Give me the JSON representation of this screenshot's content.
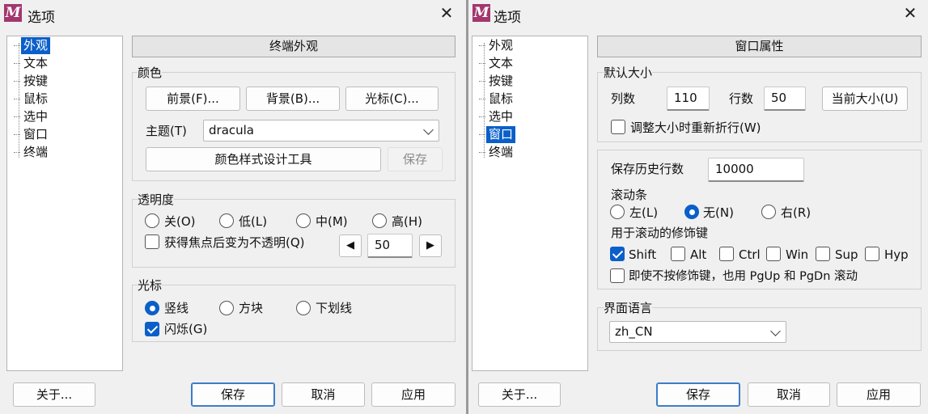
{
  "left": {
    "window_title": "选项",
    "tree": [
      "外观",
      "文本",
      "按键",
      "鼠标",
      "选中",
      "窗口",
      "终端"
    ],
    "selected_tree_index": 0,
    "panel_title": "终端外观",
    "color_group": {
      "label": "颜色",
      "fg_button": "前景(F)...",
      "bg_button": "背景(B)...",
      "cursor_button": "光标(C)...",
      "theme_label": "主题(T)",
      "theme_value": "dracula",
      "designer_button": "颜色样式设计工具",
      "save_button": "保存"
    },
    "transparency_group": {
      "label": "透明度",
      "options": [
        "关(O)",
        "低(L)",
        "中(M)",
        "高(H)"
      ],
      "selected": null,
      "opaque_on_focus_label": "获得焦点后变为不透明(Q)",
      "opaque_on_focus_checked": false,
      "value": "50"
    },
    "cursor_group": {
      "label": "光标",
      "options": [
        "竖线",
        "方块",
        "下划线"
      ],
      "selected": 0,
      "blink_label": "闪烁(G)",
      "blink_checked": true
    },
    "footer": {
      "about": "关于...",
      "save": "保存",
      "cancel": "取消",
      "apply": "应用"
    }
  },
  "right": {
    "window_title": "选项",
    "tree": [
      "外观",
      "文本",
      "按键",
      "鼠标",
      "选中",
      "窗口",
      "终端"
    ],
    "selected_tree_index": 5,
    "panel_title": "窗口属性",
    "size_group": {
      "label": "默认大小",
      "cols_label": "列数",
      "cols_value": "110",
      "rows_label": "行数",
      "rows_value": "50",
      "current_size_button": "当前大小(U)",
      "rewrap_label": "调整大小时重新折行(W)",
      "rewrap_checked": false
    },
    "scroll_group": {
      "history_label": "保存历史行数",
      "history_value": "10000",
      "scrollbar_label": "滚动条",
      "scrollbar_options": [
        "左(L)",
        "无(N)",
        "右(R)"
      ],
      "scrollbar_selected": 1,
      "modifier_label": "用于滚动的修饰键",
      "modifiers": [
        {
          "label": "Shift",
          "checked": true
        },
        {
          "label": "Alt",
          "checked": false
        },
        {
          "label": "Ctrl",
          "checked": false
        },
        {
          "label": "Win",
          "checked": false
        },
        {
          "label": "Sup",
          "checked": false
        },
        {
          "label": "Hyp",
          "checked": false
        }
      ],
      "pgup_label": "即使不按修饰键，也用 PgUp 和 PgDn 滚动",
      "pgup_checked": false
    },
    "lang_group": {
      "label": "界面语言",
      "value": "zh_CN"
    },
    "footer": {
      "about": "关于...",
      "save": "保存",
      "cancel": "取消",
      "apply": "应用"
    }
  },
  "icons": {
    "app": "M",
    "close": "✕",
    "arrow_left": "◀",
    "arrow_right": "▶"
  },
  "colors": {
    "accent": "#0a5fc9",
    "app_icon": "#a3376d"
  }
}
